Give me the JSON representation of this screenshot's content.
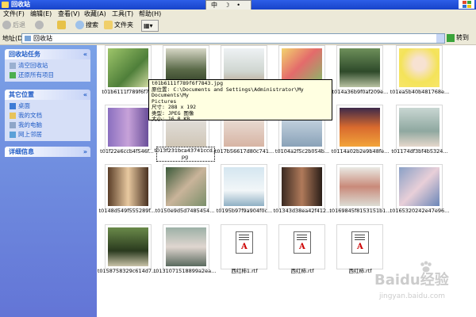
{
  "window": {
    "title": "回收站"
  },
  "ime": {
    "label": "中"
  },
  "menu": {
    "file": "文件(F)",
    "edit": "编辑(E)",
    "view": "查看(V)",
    "favorites": "收藏(A)",
    "tools": "工具(T)",
    "help": "帮助(H)"
  },
  "toolbar": {
    "back": "后退",
    "search": "搜索",
    "folders": "文件夹"
  },
  "address": {
    "label": "地址(D)",
    "value": "回收站",
    "go": "转到"
  },
  "sidebar": {
    "tasks_title": "回收站任务",
    "tasks": [
      "清空回收站",
      "还原所有项目"
    ],
    "places_title": "其它位置",
    "places": [
      "桌面",
      "我的文档",
      "我的电脑",
      "网上邻居"
    ],
    "details_title": "详细信息"
  },
  "files": [
    "t01b6111f789f6f78",
    "",
    "",
    "",
    "t014a36b9f0af209e...",
    "t01ea5b40b481768e...",
    "t01f22e6ccb4f546f...",
    "t013f231bca43741ccd.jpg",
    "t017b56617d80c741...",
    "t0104a2f5c2b054b...",
    "t0114a02b2e9b48fe...",
    "t01174df3bf4b5324...",
    "t0148d549f555289f...",
    "t0150e9d5d7485454...",
    "t0195b97f9a904f0c...",
    "t01343d38ea42f412...",
    "t0169845f8153151b1...",
    "t0165320242e47e96...",
    "t0158758329c614d7...",
    "t0131071518899a2ea...",
    "西红柿1.rtf",
    "西红柿.rtf",
    "西红柿.rtf"
  ],
  "tooltip": {
    "lines": [
      "t01b6111f789f6f7843.jpg",
      "原位置: C:\\Documents and Settings\\Administrator\\My Documents\\My",
      "Pictures",
      "尺寸: 288 x 192",
      "类型: JPEG 图像",
      "大小: 16.0 KB"
    ]
  },
  "watermark": {
    "brand": "Baidu经验",
    "url": "jingyan.baidu.com"
  },
  "colors": {
    "titlebar": "#1743c9",
    "sidebar": "#6f8ce0",
    "link": "#215dc6",
    "tooltip": "#ffffe1"
  }
}
